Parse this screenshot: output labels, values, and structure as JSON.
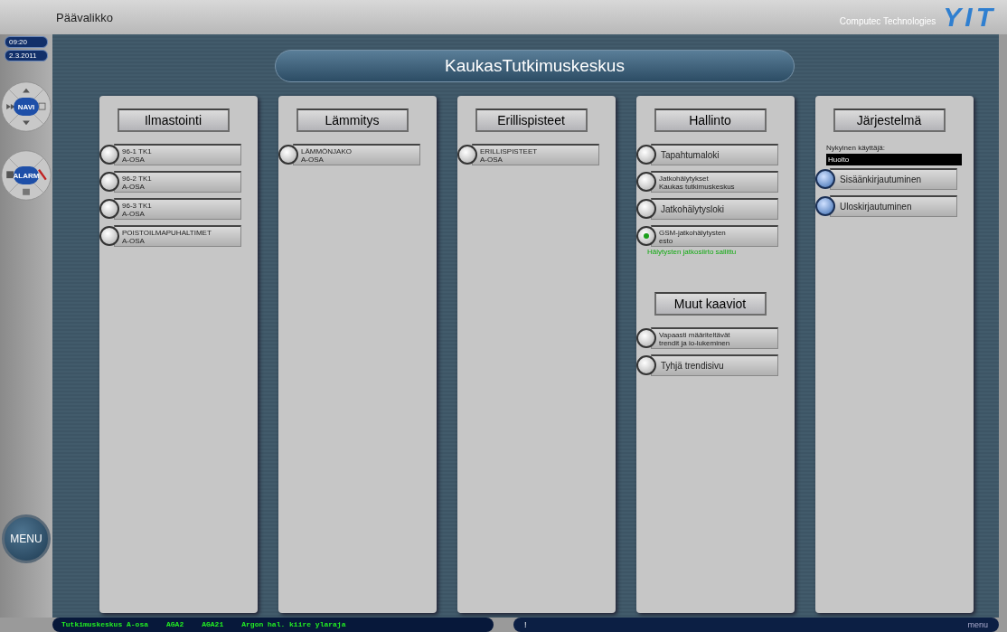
{
  "window": {
    "title": "Päävalikko",
    "vendor": "Computec Technologies",
    "logo": "YIT"
  },
  "clock": {
    "time": "09:20",
    "date": "2.3.2011"
  },
  "navigation": {
    "navi": "NAVI",
    "alarm": "ALARM",
    "menu": "MENU"
  },
  "site_title": "KaukasTutkimuskeskus",
  "panels": [
    {
      "sections": [
        {
          "title": "Ilmastointi",
          "items": [
            {
              "kind": "standard",
              "lines": [
                "96-1 TK1",
                "A-OSA"
              ],
              "on": false
            },
            {
              "kind": "standard",
              "lines": [
                "96-2 TK1",
                "A-OSA"
              ],
              "on": false
            },
            {
              "kind": "standard",
              "lines": [
                "96-3 TK1",
                "A-OSA"
              ],
              "on": false
            },
            {
              "kind": "standard",
              "lines": [
                "POISTOILMAPUHALTIMET",
                "A-OSA"
              ],
              "on": false
            }
          ]
        }
      ]
    },
    {
      "sections": [
        {
          "title": "Lämmitys",
          "items": [
            {
              "kind": "standard",
              "lines": [
                "LÄMMÖNJAKO",
                "A-OSA"
              ],
              "on": false
            }
          ]
        }
      ]
    },
    {
      "sections": [
        {
          "title": "Erillispisteet",
          "items": [
            {
              "kind": "standard",
              "lines": [
                "ERILLISPISTEET",
                "A-OSA"
              ],
              "on": false
            }
          ]
        }
      ]
    },
    {
      "sections": [
        {
          "title": "Hallinto",
          "items": [
            {
              "kind": "standard",
              "lines": [
                "Tapahtumaloki"
              ],
              "on": false
            },
            {
              "kind": "standard",
              "lines": [
                "Jatkohälytykset",
                "Kaukas tutkimuskeskus"
              ],
              "on": false
            },
            {
              "kind": "standard",
              "lines": [
                "Jatkohälytysloki"
              ],
              "on": false
            },
            {
              "kind": "standard",
              "lines": [
                "GSM-jatkohälytysten",
                "esto"
              ],
              "on": true,
              "note": "Hälytysten jatkosiirto sallittu"
            }
          ]
        },
        {
          "title": "Muut kaaviot",
          "items": [
            {
              "kind": "standard",
              "lines": [
                "Vapaasti määriteltävät",
                "trendit ja io-lukeminen"
              ],
              "on": false
            },
            {
              "kind": "standard",
              "lines": [
                "Tyhjä trendisivu"
              ],
              "on": false
            }
          ]
        }
      ]
    },
    {
      "sections": [
        {
          "title": "Järjestelmä",
          "user_label": "Nykyinen käyttäjä:",
          "user_value": "Huolto",
          "items": [
            {
              "kind": "login",
              "lines": [
                "Sisäänkirjautuminen"
              ],
              "on": false
            },
            {
              "kind": "login",
              "lines": [
                "Uloskirjautuminen"
              ],
              "on": false
            }
          ]
        }
      ]
    }
  ],
  "status_bar": {
    "alarm_fields": [
      "Tutkimuskeskus A-osa",
      "AGA2",
      "AGA21",
      "Argon hal. kiire ylaraja"
    ],
    "indicator": "!",
    "menu": "menu"
  }
}
